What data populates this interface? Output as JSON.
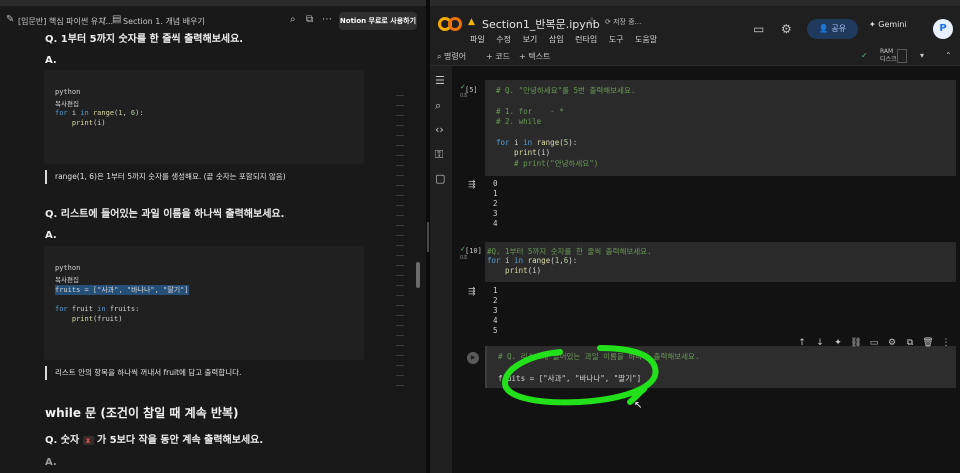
{
  "notion": {
    "breadcrumb_1": "[입문반] 핵심 파이썬 유치...",
    "breadcrumb_sep": "/",
    "breadcrumb_2": "Section 1. 개념 배우기",
    "notion_button": "Notion 무료로 사용하기",
    "q1": "Q. 1부터 5까지 숫자를 한 줄씩 출력해보세요.",
    "a_label": "A.",
    "code1": {
      "lang": "python",
      "copy": "복사편집",
      "line3_kw": "for",
      "line3_rest_a": " i ",
      "line3_in": "in",
      "line3_fn": " range",
      "line3_args_open": "(",
      "line3_num1": "1",
      "line3_comma": ", ",
      "line3_num2": "6",
      "line3_close": "):",
      "line4_fn": "    print",
      "line4_args": "(i)"
    },
    "callout1": "range(1, 6)은 1부터 5까지 숫자를 생성해요. (끝 숫자는 포함되지 않음)",
    "q2": "Q. 리스트에 들어있는 과일 이름을 하나씩 출력해보세요.",
    "code2": {
      "lang": "python",
      "copy": "복사편집",
      "line3": "fruits = [\"사과\", \"바나나\", \"딸기\"]",
      "line5_kw": "for",
      "line5_rest": " fruit ",
      "line5_in": "in",
      "line5_tail": " fruits:",
      "line6_fn": "    print",
      "line6_args": "(fruit)"
    },
    "callout2": "리스트 안의 항목을 하나씩 꺼내서 fruit에 담고 출력합니다.",
    "h2": "while 문 (조건이 참일 때 계속 반복)",
    "q3_pre": "Q. 숫자 ",
    "q3_x": "x",
    "q3_post": " 가 5보다 작을 동안 계속 출력해보세요."
  },
  "colab": {
    "title": "Section1_반복문.ipynb",
    "save_status": "저장 중...",
    "menu": [
      "파일",
      "수정",
      "보기",
      "삽입",
      "런타임",
      "도구",
      "도움말"
    ],
    "share": "공유",
    "gemini": "Gemini",
    "avatar": "P",
    "toolbar_search": "명령어",
    "toolbar_code": "+ 코드",
    "toolbar_text": "+ 텍스트",
    "ram": "RAM",
    "disk": "디스크",
    "cell1": {
      "exec": "[5]",
      "time": "0초",
      "l1": "# Q. \"안녕하세요\"를 5번 출력해보세요.",
      "l3": "# 1. for    - *",
      "l4": "# 2. while",
      "l6a": "for",
      "l6b": " i ",
      "l6c": "in",
      "l6d": " range",
      "l6e": "(",
      "l6f": "5",
      "l6g": "):",
      "l7a": "    print",
      "l7b": "(i)",
      "l8": "    # print(\"안녕하세요\")",
      "outputs": [
        "0",
        "1",
        "2",
        "3",
        "4"
      ]
    },
    "cell2": {
      "exec": "[10]",
      "time": "0초",
      "l1": "#Q. 1부터 5까지 숫자를 한 줄씩 출력해보세요.",
      "l2a": "for",
      "l2b": " i ",
      "l2c": "in",
      "l2d": " range",
      "l2e": "(",
      "l2f": "1",
      "l2g": ",",
      "l2h": "6",
      "l2i": "):",
      "l3a": "    print",
      "l3b": "(i)",
      "outputs": [
        "1",
        "2",
        "3",
        "4",
        "5"
      ]
    },
    "cell3": {
      "l1": "# Q. 리스트에 들어있는 과일 이름을 하나씩 출력해보세요.",
      "l3": "fruits = [\"사과\", \"바나나\", \"딸기\"]"
    },
    "annotation_color": "#22e01a"
  }
}
